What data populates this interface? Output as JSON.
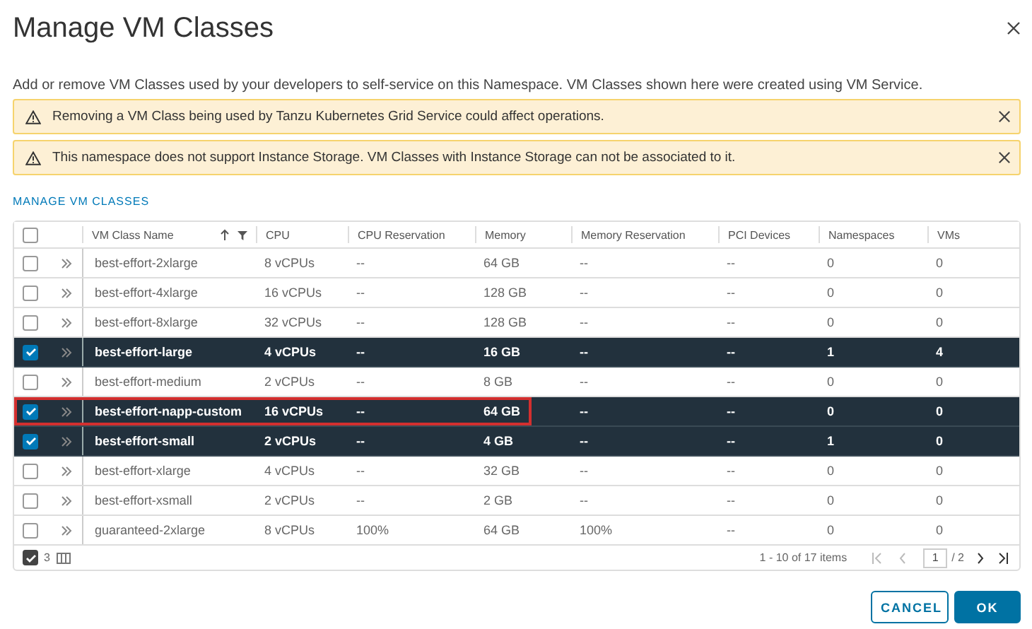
{
  "dialog": {
    "title": "Manage VM Classes",
    "description": "Add or remove VM Classes used by your developers to self-service on this Namespace. VM Classes shown here were created using VM Service."
  },
  "alerts": [
    {
      "kind": "warning",
      "text": "Removing a VM Class being used by Tanzu Kubernetes Grid Service could affect operations."
    },
    {
      "kind": "warning",
      "text": "This namespace does not support Instance Storage. VM Classes with Instance Storage can not be associated to it."
    }
  ],
  "link": "MANAGE VM CLASSES",
  "table": {
    "select_all_checked": false,
    "columns": [
      {
        "label": "VM Class Name",
        "sorted": true,
        "filter": true
      },
      {
        "label": "CPU",
        "sorted": false,
        "filter": false
      },
      {
        "label": "CPU Reservation",
        "sorted": false,
        "filter": false
      },
      {
        "label": "Memory",
        "sorted": false,
        "filter": false
      },
      {
        "label": "Memory Reservation",
        "sorted": false,
        "filter": false
      },
      {
        "label": "PCI Devices",
        "sorted": false,
        "filter": false
      },
      {
        "label": "Namespaces",
        "sorted": false,
        "filter": false
      },
      {
        "label": "VMs",
        "sorted": false,
        "filter": false
      }
    ],
    "rows": [
      {
        "selected": false,
        "highlighted": false,
        "cells": [
          "best-effort-2xlarge",
          "8 vCPUs",
          "--",
          "64 GB",
          "--",
          "--",
          "0",
          "0"
        ]
      },
      {
        "selected": false,
        "highlighted": false,
        "cells": [
          "best-effort-4xlarge",
          "16 vCPUs",
          "--",
          "128 GB",
          "--",
          "--",
          "0",
          "0"
        ]
      },
      {
        "selected": false,
        "highlighted": false,
        "cells": [
          "best-effort-8xlarge",
          "32 vCPUs",
          "--",
          "128 GB",
          "--",
          "--",
          "0",
          "0"
        ]
      },
      {
        "selected": true,
        "highlighted": false,
        "cells": [
          "best-effort-large",
          "4 vCPUs",
          "--",
          "16 GB",
          "--",
          "--",
          "1",
          "4"
        ]
      },
      {
        "selected": false,
        "highlighted": false,
        "cells": [
          "best-effort-medium",
          "2 vCPUs",
          "--",
          "8 GB",
          "--",
          "--",
          "0",
          "0"
        ]
      },
      {
        "selected": true,
        "highlighted": true,
        "cells": [
          "best-effort-napp-custom",
          "16 vCPUs",
          "--",
          "64 GB",
          "--",
          "--",
          "0",
          "0"
        ]
      },
      {
        "selected": true,
        "highlighted": false,
        "cells": [
          "best-effort-small",
          "2 vCPUs",
          "--",
          "4 GB",
          "--",
          "--",
          "1",
          "0"
        ]
      },
      {
        "selected": false,
        "highlighted": false,
        "cells": [
          "best-effort-xlarge",
          "4 vCPUs",
          "--",
          "32 GB",
          "--",
          "--",
          "0",
          "0"
        ]
      },
      {
        "selected": false,
        "highlighted": false,
        "cells": [
          "best-effort-xsmall",
          "2 vCPUs",
          "--",
          "2 GB",
          "--",
          "--",
          "0",
          "0"
        ]
      },
      {
        "selected": false,
        "highlighted": false,
        "cells": [
          "guaranteed-2xlarge",
          "8 vCPUs",
          "100%",
          "64 GB",
          "100%",
          "--",
          "0",
          "0"
        ]
      }
    ],
    "footer": {
      "selected_checked": true,
      "selected_count": "3",
      "range": "1 - 10 of 17 items",
      "page": "1",
      "pages": "/ 2"
    }
  },
  "buttons": [
    {
      "kind": "secondary",
      "label": "CANCEL"
    },
    {
      "kind": "primary",
      "label": "OK"
    }
  ]
}
